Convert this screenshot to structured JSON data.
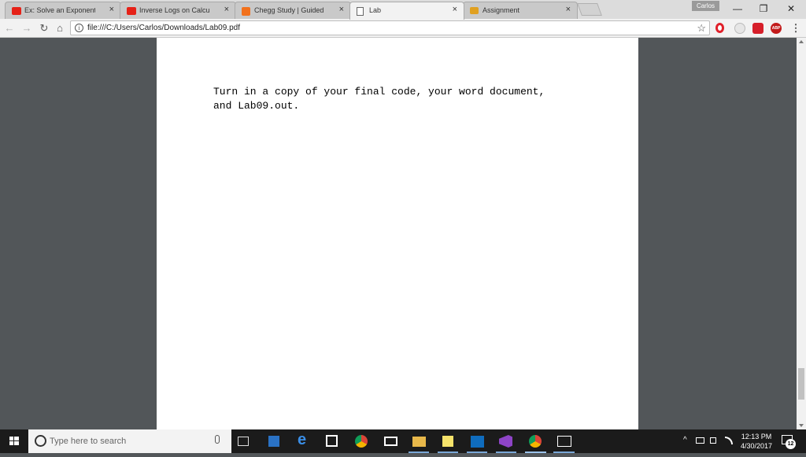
{
  "browser": {
    "tabs": [
      {
        "title": "Ex: Solve an Exponential",
        "favicon": "youtube-icon",
        "color": "#e62117"
      },
      {
        "title": "Inverse Logs on Calculat",
        "favicon": "youtube-icon",
        "color": "#e62117"
      },
      {
        "title": "Chegg Study | Guided So",
        "favicon": "chegg-icon",
        "color": "#f2711c"
      },
      {
        "title": "Lab",
        "favicon": "document-icon",
        "color": "#ffffff"
      },
      {
        "title": "Assignment",
        "favicon": "assignment-icon",
        "color": "#e0a020"
      }
    ],
    "close_glyph": "×",
    "profile_name": "Carlos",
    "window_controls": {
      "minimize": "—",
      "restore": "❐",
      "close": "✕"
    },
    "toolbar": {
      "back": "←",
      "forward": "→",
      "reload": "↻",
      "home": "⌂",
      "bookmark_star": "☆",
      "menu": "⋮"
    },
    "address": {
      "url": "file:///C:/Users/Carlos/Downloads/Lab09.pdf",
      "info_glyph": "i"
    },
    "extensions": {
      "abp_label": "ABP"
    }
  },
  "document": {
    "lines": [
      "Turn in a copy of your final code, your word document,",
      "and Lab09.out."
    ]
  },
  "taskbar": {
    "search_placeholder": "Type here to search",
    "clock_time": "12:13 PM",
    "clock_date": "4/30/2017",
    "notification_count": "12",
    "tray_chevron": "^"
  }
}
